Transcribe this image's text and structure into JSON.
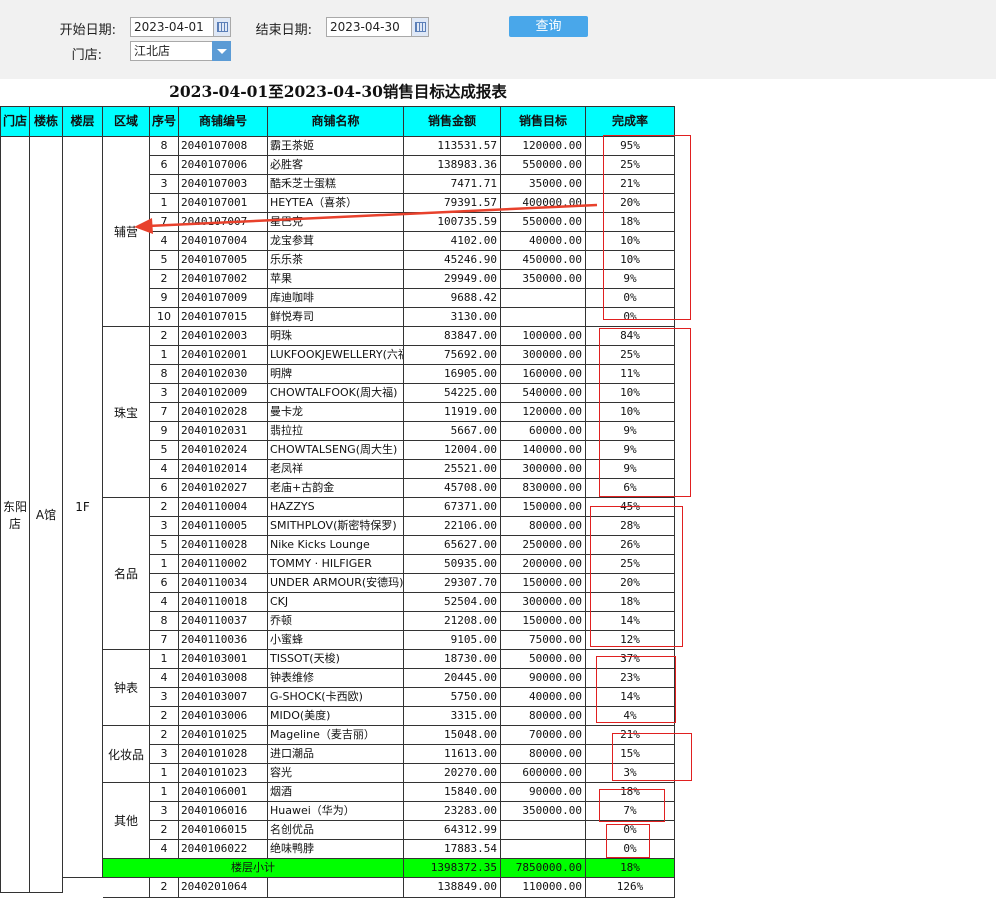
{
  "filters": {
    "start_label": "开始日期:",
    "start_value": "2023-04-01",
    "end_label": "结束日期:",
    "end_value": "2023-04-30",
    "store_label": "门店:",
    "store_value": "江北店",
    "query_label": "查询"
  },
  "report": {
    "title": "2023-04-01至2023-04-30销售目标达成报表",
    "headers": [
      "门店",
      "楼栋",
      "楼层",
      "区域",
      "序号",
      "商铺编号",
      "商铺名称",
      "销售金额",
      "销售目标",
      "完成率"
    ],
    "store": "东阳店",
    "building": "A馆",
    "floor": "1F",
    "groups": [
      {
        "area": "辅营",
        "rows": [
          [
            "8",
            "2040107008",
            "霸王茶姬",
            "113531.57",
            "120000.00",
            "95%"
          ],
          [
            "6",
            "2040107006",
            "必胜客",
            "138983.36",
            "550000.00",
            "25%"
          ],
          [
            "3",
            "2040107003",
            "酷禾芝士蛋糕",
            "7471.71",
            "35000.00",
            "21%"
          ],
          [
            "1",
            "2040107001",
            "HEYTEA（喜茶）",
            "79391.57",
            "400000.00",
            "20%"
          ],
          [
            "7",
            "2040107007",
            "星巴克",
            "100735.59",
            "550000.00",
            "18%"
          ],
          [
            "4",
            "2040107004",
            "龙宝参茸",
            "4102.00",
            "40000.00",
            "10%"
          ],
          [
            "5",
            "2040107005",
            "乐乐茶",
            "45246.90",
            "450000.00",
            "10%"
          ],
          [
            "2",
            "2040107002",
            "苹果",
            "29949.00",
            "350000.00",
            "9%"
          ],
          [
            "9",
            "2040107009",
            "库迪咖啡",
            "9688.42",
            "",
            "0%"
          ],
          [
            "10",
            "2040107015",
            "鲜悦寿司",
            "3130.00",
            "",
            "0%"
          ]
        ]
      },
      {
        "area": "珠宝",
        "rows": [
          [
            "2",
            "2040102003",
            "明珠",
            "83847.00",
            "100000.00",
            "84%"
          ],
          [
            "1",
            "2040102001",
            "LUKFOOKJEWELLERY(六福)",
            "75692.00",
            "300000.00",
            "25%"
          ],
          [
            "8",
            "2040102030",
            "明牌",
            "16905.00",
            "160000.00",
            "11%"
          ],
          [
            "3",
            "2040102009",
            "CHOWTALFOOK(周大福)",
            "54225.00",
            "540000.00",
            "10%"
          ],
          [
            "7",
            "2040102028",
            "曼卡龙",
            "11919.00",
            "120000.00",
            "10%"
          ],
          [
            "9",
            "2040102031",
            "翡拉拉",
            "5667.00",
            "60000.00",
            "9%"
          ],
          [
            "5",
            "2040102024",
            "CHOWTALSENG(周大生)",
            "12004.00",
            "140000.00",
            "9%"
          ],
          [
            "4",
            "2040102014",
            "老凤祥",
            "25521.00",
            "300000.00",
            "9%"
          ],
          [
            "6",
            "2040102027",
            "老庙+古韵金",
            "45708.00",
            "830000.00",
            "6%"
          ]
        ]
      },
      {
        "area": "名品",
        "rows": [
          [
            "2",
            "2040110004",
            "HAZZYS",
            "67371.00",
            "150000.00",
            "45%"
          ],
          [
            "3",
            "2040110005",
            "SMITHPLOV(斯密特保罗)",
            "22106.00",
            "80000.00",
            "28%"
          ],
          [
            "5",
            "2040110028",
            "Nike Kicks Lounge",
            "65627.00",
            "250000.00",
            "26%"
          ],
          [
            "1",
            "2040110002",
            "TOMMY · HILFIGER",
            "50935.00",
            "200000.00",
            "25%"
          ],
          [
            "6",
            "2040110034",
            "UNDER ARMOUR(安德玛)",
            "29307.70",
            "150000.00",
            "20%"
          ],
          [
            "4",
            "2040110018",
            "CKJ",
            "52504.00",
            "300000.00",
            "18%"
          ],
          [
            "8",
            "2040110037",
            "乔顿",
            "21208.00",
            "150000.00",
            "14%"
          ],
          [
            "7",
            "2040110036",
            "小蜜蜂",
            "9105.00",
            "75000.00",
            "12%"
          ]
        ]
      },
      {
        "area": "钟表",
        "rows": [
          [
            "1",
            "2040103001",
            "TISSOT(天梭)",
            "18730.00",
            "50000.00",
            "37%"
          ],
          [
            "4",
            "2040103008",
            "钟表维修",
            "20445.00",
            "90000.00",
            "23%"
          ],
          [
            "3",
            "2040103007",
            "G-SHOCK(卡西欧)",
            "5750.00",
            "40000.00",
            "14%"
          ],
          [
            "2",
            "2040103006",
            "MIDO(美度)",
            "3315.00",
            "80000.00",
            "4%"
          ]
        ]
      },
      {
        "area": "化妆品",
        "rows": [
          [
            "2",
            "2040101025",
            "Mageline（麦吉丽）",
            "15048.00",
            "70000.00",
            "21%"
          ],
          [
            "3",
            "2040101028",
            "进口潮品",
            "11613.00",
            "80000.00",
            "15%"
          ],
          [
            "1",
            "2040101023",
            "容光",
            "20270.00",
            "600000.00",
            "3%"
          ]
        ]
      },
      {
        "area": "其他",
        "rows": [
          [
            "1",
            "2040106001",
            "烟酒",
            "15840.00",
            "90000.00",
            "18%"
          ],
          [
            "3",
            "2040106016",
            "Huawei（华为）",
            "23283.00",
            "350000.00",
            "7%"
          ],
          [
            "2",
            "2040106015",
            "名创优品",
            "64312.99",
            "",
            "0%"
          ],
          [
            "4",
            "2040106022",
            "绝味鸭脖",
            "17883.54",
            "",
            "0%"
          ]
        ]
      }
    ],
    "subtotal": {
      "label": "楼层小计",
      "sales": "1398372.35",
      "target": "7850000.00",
      "rate": "18%"
    },
    "next_row": [
      "2",
      "2040201064",
      "",
      "138849.00",
      "110000.00",
      "126%"
    ]
  },
  "colors": {
    "header_bg": "#00ffff",
    "subtotal_bg": "#00ff00",
    "annotation": "#e02020",
    "query_button": "#49a7ea"
  }
}
